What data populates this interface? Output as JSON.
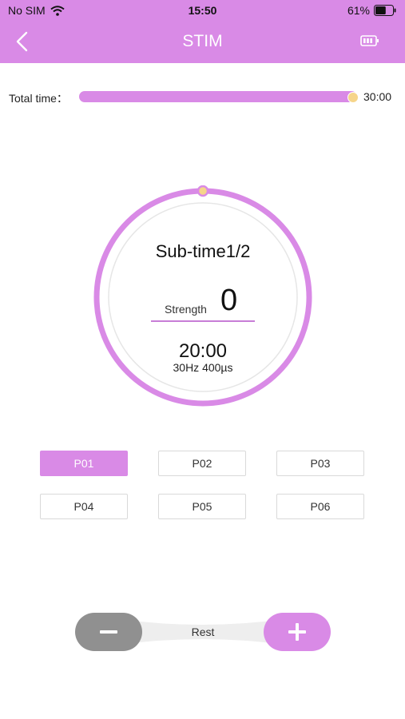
{
  "status_bar": {
    "carrier": "No SIM",
    "time": "15:50",
    "battery_percent": "61%",
    "battery_level": 0.61
  },
  "header": {
    "title": "STIM",
    "back_icon": "chevron-left-icon",
    "device_battery_icon": "battery-icon"
  },
  "total_time": {
    "label": "Total time：",
    "value": "30:00",
    "slider_fraction": 1.0
  },
  "dial": {
    "subtime": "Sub-time1/2",
    "strength_label": "Strength",
    "strength_value": "0",
    "time": "20:00",
    "params": "30Hz  400µs",
    "progress_fraction": 1.0
  },
  "programs": [
    {
      "label": "P01",
      "selected": true
    },
    {
      "label": "P02",
      "selected": false
    },
    {
      "label": "P03",
      "selected": false
    },
    {
      "label": "P04",
      "selected": false
    },
    {
      "label": "P05",
      "selected": false
    },
    {
      "label": "P06",
      "selected": false
    }
  ],
  "controls": {
    "rest_label": "Rest",
    "minus_icon": "minus-icon",
    "plus_icon": "plus-icon"
  },
  "colors": {
    "accent": "#d98ae6",
    "thumb": "#f6d58a",
    "minus_button": "#909090"
  }
}
